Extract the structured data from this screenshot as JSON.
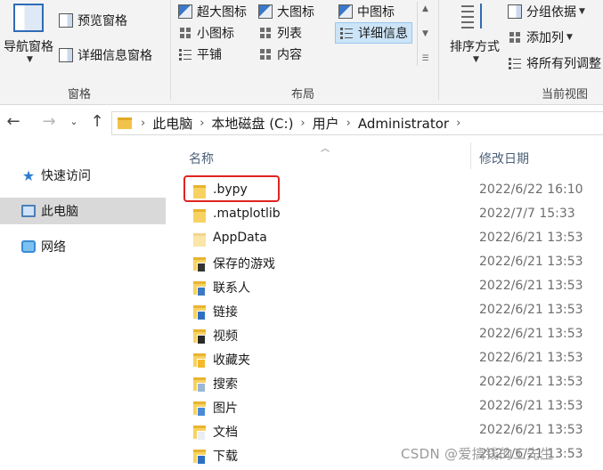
{
  "ribbon": {
    "pane_group": {
      "nav_pane_label": "导航窗格",
      "preview_pane_label": "预览窗格",
      "details_pane_label": "详细信息窗格",
      "group_label": "窗格"
    },
    "layout_group": {
      "items": [
        "超大图标",
        "大图标",
        "中图标",
        "小图标",
        "列表",
        "详细信息",
        "平铺",
        "内容"
      ],
      "selected": "详细信息",
      "group_label": "布局"
    },
    "current_view_group": {
      "sort_label": "排序方式",
      "group_by_label": "分组依据",
      "add_column_label": "添加列",
      "fit_columns_label": "将所有列调整",
      "group_label": "当前视图"
    }
  },
  "address": {
    "breadcrumbs": [
      "此电脑",
      "本地磁盘 (C:)",
      "用户",
      "Administrator"
    ]
  },
  "navigation_pane": {
    "items": [
      {
        "label": "快速访问",
        "icon": "star-icon"
      },
      {
        "label": "此电脑",
        "icon": "computer-icon",
        "selected": true
      },
      {
        "label": "网络",
        "icon": "network-icon"
      }
    ]
  },
  "file_list": {
    "columns": {
      "name": "名称",
      "modified": "修改日期"
    },
    "files": [
      {
        "name": ".bypy",
        "modified": "2022/6/22 16:10",
        "icon": "folder-icon",
        "highlighted": true
      },
      {
        "name": ".matplotlib",
        "modified": "2022/7/7 15:33",
        "icon": "folder-icon"
      },
      {
        "name": "AppData",
        "modified": "2022/6/21 13:53",
        "icon": "folder-icon"
      },
      {
        "name": "保存的游戏",
        "modified": "2022/6/21 13:53",
        "icon": "saved-games-folder-icon"
      },
      {
        "name": "联系人",
        "modified": "2022/6/21 13:53",
        "icon": "contacts-folder-icon"
      },
      {
        "name": "链接",
        "modified": "2022/6/21 13:53",
        "icon": "links-folder-icon"
      },
      {
        "name": "视频",
        "modified": "2022/6/21 13:53",
        "icon": "videos-folder-icon"
      },
      {
        "name": "收藏夹",
        "modified": "2022/6/21 13:53",
        "icon": "favorites-folder-icon"
      },
      {
        "name": "搜索",
        "modified": "2022/6/21 13:53",
        "icon": "searches-folder-icon"
      },
      {
        "name": "图片",
        "modified": "2022/6/21 13:53",
        "icon": "pictures-folder-icon"
      },
      {
        "name": "文档",
        "modified": "2022/6/21 13:53",
        "icon": "documents-folder-icon"
      },
      {
        "name": "下载",
        "modified": "2022/6/21 13:53",
        "icon": "downloads-folder-icon"
      }
    ]
  },
  "watermark": "CSDN @爱搞钱的工先生",
  "colors": {
    "selection_bg": "#cce4f7",
    "highlight_border": "#e0241f",
    "folder_yellow": "#f7d262"
  }
}
